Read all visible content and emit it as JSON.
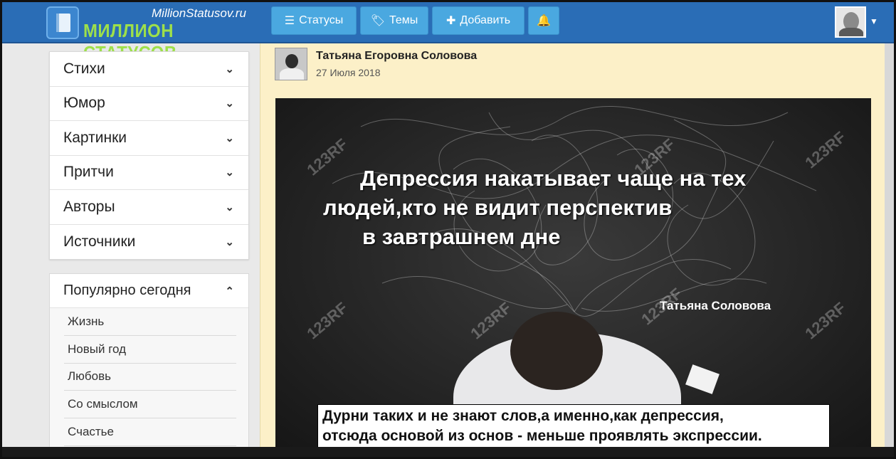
{
  "header": {
    "logo_site": "MillionStatusov.ru",
    "logo_name": "МИЛЛИОН СТАТУСОВ",
    "buttons": [
      {
        "label": "Статусы",
        "icon": "list-icon"
      },
      {
        "label": "Темы",
        "icon": "tag-icon"
      },
      {
        "label": "Добавить",
        "icon": "plus-icon"
      },
      {
        "label": "",
        "icon": "bell-icon"
      }
    ]
  },
  "sidebar": {
    "categories": [
      {
        "label": "Стихи"
      },
      {
        "label": "Юмор"
      },
      {
        "label": "Картинки"
      },
      {
        "label": "Притчи"
      },
      {
        "label": "Авторы"
      },
      {
        "label": "Источники"
      }
    ],
    "popular": {
      "title": "Популярно сегодня",
      "items": [
        "Жизнь",
        "Новый год",
        "Любовь",
        "Со смыслом",
        "Счастье"
      ]
    }
  },
  "post": {
    "author": "Татьяна Егоровна Соловова",
    "date": "27 Июля 2018",
    "quote_lines": [
      "Депрессия накатывает чаще на тех",
      "людей,кто не видит перспектив",
      "в завтрашнем дне"
    ],
    "image_signature": "Татьяна Соловова",
    "watermark": "123RF"
  },
  "caption": {
    "line1": "Дурни таких и не знают слов,а именно,как депрессия,",
    "line2": "отсюда основой из основ - меньше проявлять экспрессии."
  },
  "colors": {
    "navbar": "#2a6db6",
    "nav_button": "#4aa8e0",
    "logo_green": "#9ee04a",
    "post_bg": "#fcf0c8"
  }
}
